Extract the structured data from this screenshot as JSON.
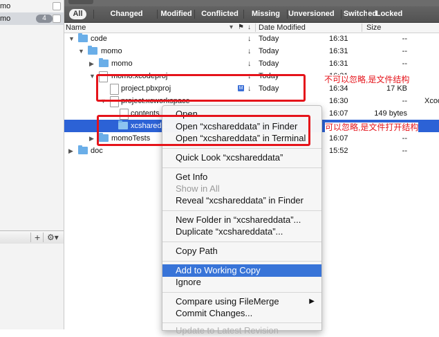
{
  "sidebar": {
    "items": [
      {
        "label": "mo",
        "checked": false
      },
      {
        "label": "mo",
        "badge": "4",
        "checked": false
      }
    ],
    "bottom": {
      "add_label": "+",
      "gear_label": "⚙▾"
    }
  },
  "filters": [
    "All",
    "Changed",
    "Modified",
    "Conflicted",
    "Missing",
    "Unversioned",
    "Switched",
    "Locked"
  ],
  "columns": {
    "name": "Name",
    "date": "Date Modified",
    "size": "Size"
  },
  "rows": [
    {
      "name": "code",
      "date": "Today",
      "time": "16:31",
      "size": "--"
    },
    {
      "name": "momo",
      "date": "Today",
      "time": "16:31",
      "size": "--"
    },
    {
      "name": "momo",
      "date": "Today",
      "time": "16:31",
      "size": "--"
    },
    {
      "name": "momo.xcodeproj",
      "date": "Today",
      "time": "16:31",
      "size": "--"
    },
    {
      "name": "project.pbxproj",
      "badge": "M",
      "date": "Today",
      "time": "16:34",
      "size": "17 KB"
    },
    {
      "name": "project.xcworkspace",
      "date": "",
      "time": "16:30",
      "size": "--",
      "extra": "Xcod"
    },
    {
      "name": "contents",
      "date": "",
      "time": "16:07",
      "size": "149 bytes"
    },
    {
      "name": "xcshareddata",
      "date": "",
      "time": "",
      "size": ""
    },
    {
      "name": "momoTests",
      "date": "",
      "time": "16:07",
      "size": "--"
    },
    {
      "name": "doc",
      "date": "",
      "time": "15:52",
      "size": "--"
    }
  ],
  "menu": {
    "open": "Open",
    "open_in_finder": "Open “xcshareddata” in Finder",
    "open_in_terminal": "Open “xcshareddata” in Terminal",
    "quick_look": "Quick Look “xcshareddata”",
    "get_info": "Get Info",
    "show_in_all": "Show in All",
    "reveal_in_finder": "Reveal “xcshareddata” in Finder",
    "new_folder": "New Folder in “xcshareddata”...",
    "duplicate": "Duplicate “xcshareddata”...",
    "copy_path": "Copy Path",
    "add_to_working_copy": "Add to Working Copy",
    "ignore": "Ignore",
    "compare": "Compare using FileMerge",
    "commit": "Commit Changes...",
    "last_partial": "Update to Latest Revision"
  },
  "annotations": {
    "note1": "不可以忽略,是文件结构",
    "note2": "可以忽略,是文件打开结构"
  },
  "colors": {
    "annotation": "#e5131a",
    "selection": "#2c62d6",
    "menu_highlight": "#3874d8"
  }
}
